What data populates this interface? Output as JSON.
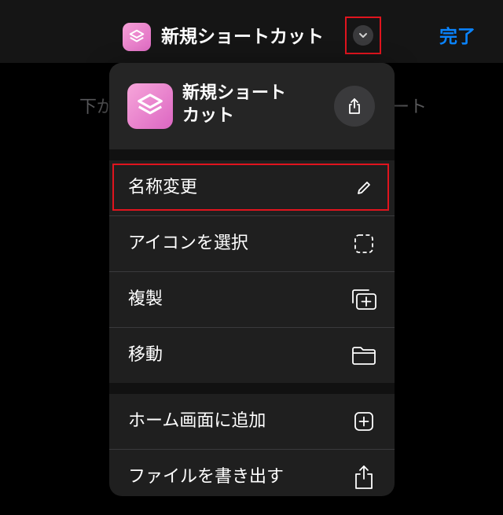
{
  "navbar": {
    "title": "新規ショートカット",
    "done_label": "完了",
    "app_icon": "shortcuts-layers-icon",
    "menu_toggle_icon": "chevron-down-icon"
  },
  "background_hint": {
    "left_fragment": "下が",
    "right_fragment": "ート"
  },
  "menu": {
    "header": {
      "title": "新規ショートカット",
      "icon": "shortcuts-layers-icon",
      "share_icon": "share-icon"
    },
    "items": [
      {
        "label": "名称変更",
        "icon": "pencil-icon"
      },
      {
        "label": "アイコンを選択",
        "icon": "dashed-square-icon"
      },
      {
        "label": "複製",
        "icon": "duplicate-icon"
      },
      {
        "label": "移動",
        "icon": "folder-icon"
      },
      {
        "label": "ホーム画面に追加",
        "icon": "plus-square-icon"
      },
      {
        "label": "ファイルを書き出す",
        "icon": "share-icon"
      }
    ]
  },
  "colors": {
    "accent": "#0a84ff",
    "highlight_border": "#e0141e",
    "shortcut_icon_gradient": [
      "#f59fd6",
      "#df6bc3"
    ],
    "menu_background": "#1f1f1f"
  }
}
